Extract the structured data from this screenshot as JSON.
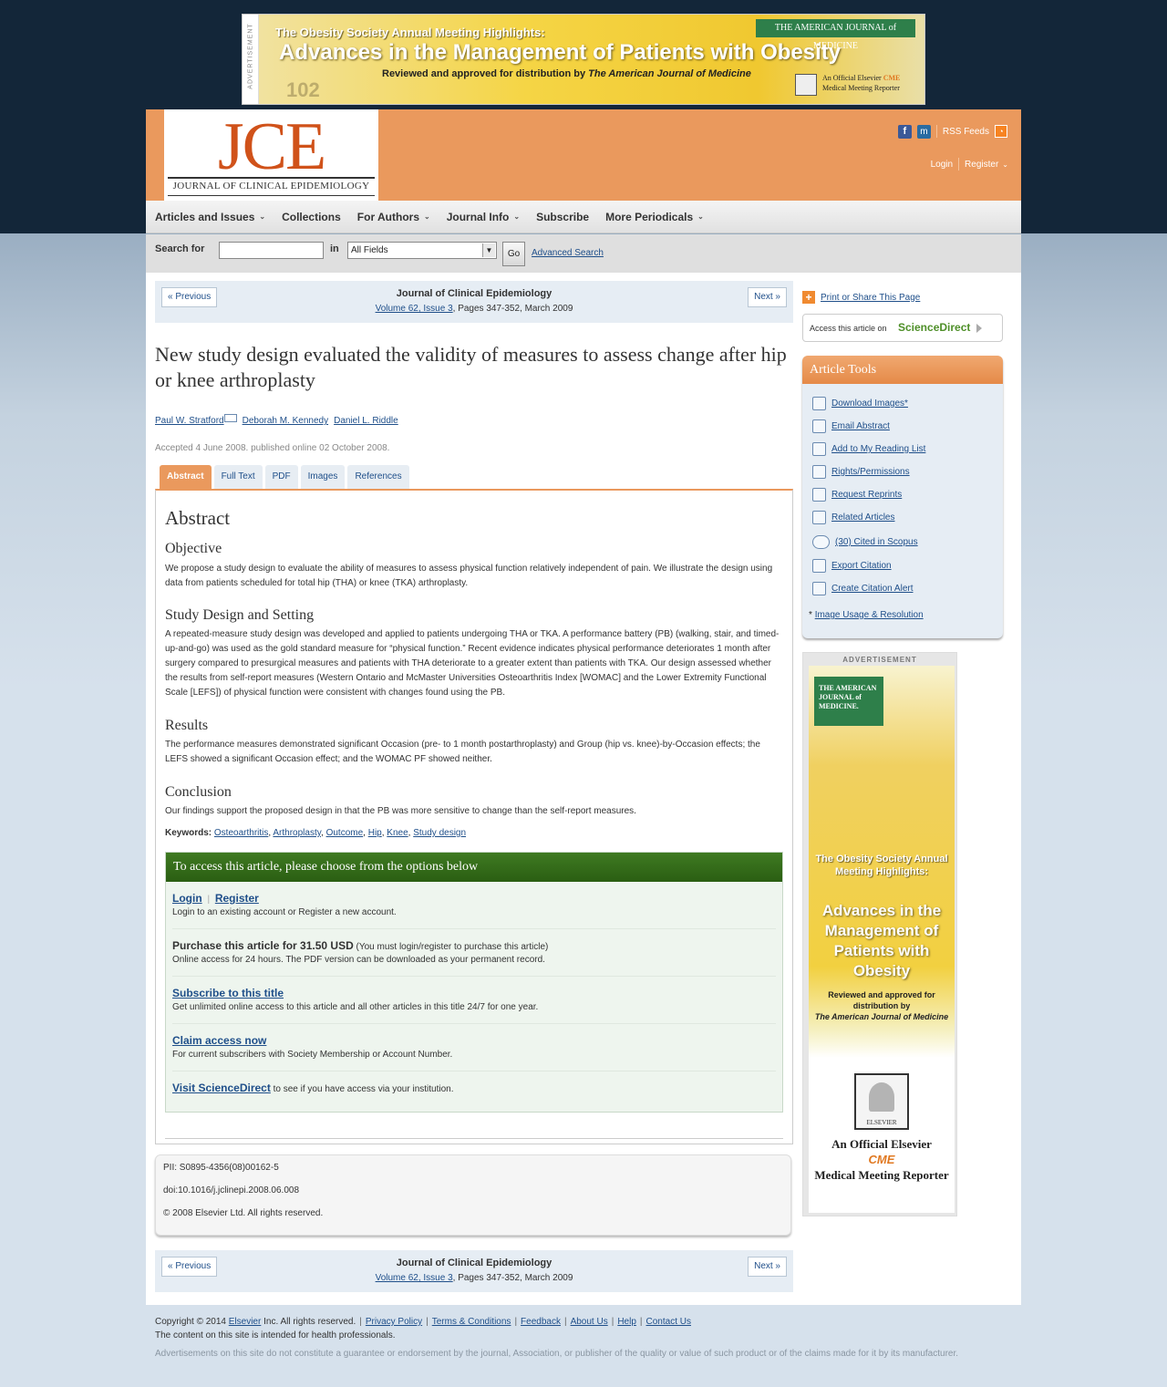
{
  "top_ad": {
    "side_label": "ADVERTISEMENT",
    "line1": "The Obesity Society Annual Meeting Highlights:",
    "line2": "Advances in the Management of Patients with Obesity",
    "line3_prefix": "Reviewed and approved for distribution by",
    "line3_journal": "The American Journal of Medicine",
    "publisher": "THE AMERICAN JOURNAL of MEDICINE",
    "cme_line1": "An Official Elsevier",
    "cme_badge": "CME",
    "cme_line2": "Medical Meeting Reporter",
    "number": "102"
  },
  "header": {
    "logo_text": "JCE",
    "logo_subtitle": "JOURNAL OF CLINICAL EPIDEMIOLOGY",
    "facebook_glyph": "f",
    "mendeley_glyph": "m",
    "rss_label": "RSS Feeds",
    "login": "Login",
    "register": "Register"
  },
  "nav": {
    "items": [
      {
        "label": "Articles and Issues",
        "dropdown": true
      },
      {
        "label": "Collections",
        "dropdown": false
      },
      {
        "label": "For Authors",
        "dropdown": true
      },
      {
        "label": "Journal Info",
        "dropdown": true
      },
      {
        "label": "Subscribe",
        "dropdown": false
      },
      {
        "label": "More Periodicals",
        "dropdown": true
      }
    ]
  },
  "search": {
    "label": "Search for",
    "input_value": "",
    "in_label": "in",
    "field_selected": "All Fields",
    "go_label": "Go",
    "advanced_label": "Advanced Search"
  },
  "issue_nav": {
    "prev_label": "« Previous",
    "next_label": "Next »",
    "journal": "Journal of Clinical Epidemiology",
    "volume_link": "Volume 62, Issue 3",
    "pages": ", Pages 347-352, March 2009"
  },
  "article": {
    "title": "New study design evaluated the validity of measures to assess change after hip or knee arthroplasty",
    "authors": [
      "Paul W. Stratford",
      "Deborah M. Kennedy",
      "Daniel L. Riddle"
    ],
    "accepted": "Accepted 4 June 2008. published online 02 October 2008.",
    "tabs": [
      "Abstract",
      "Full Text",
      "PDF",
      "Images",
      "References"
    ],
    "active_tab": "Abstract"
  },
  "abstract": {
    "heading": "Abstract",
    "sections": [
      {
        "heading": "Objective",
        "text": "We propose a study design to evaluate the ability of measures to assess physical function relatively independent of pain. We illustrate the design using data from patients scheduled for total hip (THA) or knee (TKA) arthroplasty."
      },
      {
        "heading": "Study Design and Setting",
        "text": "A repeated-measure study design was developed and applied to patients undergoing THA or TKA. A performance battery (PB) (walking, stair, and timed-up-and-go) was used as the gold standard measure for “physical function.” Recent evidence indicates physical performance deteriorates 1 month after surgery compared to presurgical measures and patients with THA deteriorate to a greater extent than patients with TKA. Our design assessed whether the results from self-report measures (Western Ontario and McMaster Universities Osteoarthritis Index [WOMAC] and the Lower Extremity Functional Scale [LEFS]) of physical function were consistent with changes found using the PB."
      },
      {
        "heading": "Results",
        "text": "The performance measures demonstrated significant Occasion (pre- to 1 month postarthroplasty) and Group (hip vs. knee)-by-Occasion effects; the LEFS showed a significant Occasion effect; and the WOMAC PF showed neither."
      },
      {
        "heading": "Conclusion",
        "text": "Our findings support the proposed design in that the PB was more sensitive to change than the self-report measures."
      }
    ],
    "keywords_label": "Keywords:",
    "keywords": [
      "Osteoarthritis",
      "Arthroplasty",
      "Outcome",
      "Hip",
      "Knee",
      "Study design"
    ]
  },
  "access": {
    "heading": "To access this article, please choose from the options below",
    "login": "Login",
    "register": "Register",
    "login_desc": "Login to an existing account or Register a new account.",
    "purchase_title": "Purchase this article for 31.50 USD",
    "purchase_note": "(You must login/register to purchase this article)",
    "purchase_desc": "Online access for 24 hours. The PDF version can be downloaded as your permanent record.",
    "subscribe_title": "Subscribe to this title",
    "subscribe_desc": "Get unlimited online access to this article and all other articles in this title 24/7 for one year.",
    "claim_title": "Claim access now",
    "claim_desc": "For current subscribers with Society Membership or Account Number.",
    "visit_title": "Visit ScienceDirect",
    "visit_desc": "to see if you have access via your institution."
  },
  "identifiers": {
    "pii": "PII: S0895-4356(08)00162-5",
    "doi": "doi:10.1016/j.jclinepi.2008.06.008",
    "copyright": "© 2008 Elsevier Ltd. All rights reserved."
  },
  "sidebar": {
    "print_share": "Print or Share This Page",
    "access_on": "Access this article on",
    "sciencedirect": "ScienceDirect",
    "tools_heading": "Article Tools",
    "tools": [
      {
        "label": "Download Images*",
        "icon": "download-images-icon"
      },
      {
        "label": "Email Abstract",
        "icon": "email-icon"
      },
      {
        "label": "Add to My Reading List",
        "icon": "reading-list-icon"
      },
      {
        "label": "Rights/Permissions",
        "icon": "lock-icon"
      },
      {
        "label": "Request Reprints",
        "icon": "reprints-icon"
      },
      {
        "label": "Related Articles",
        "icon": "related-articles-icon"
      },
      {
        "label": "(30) Cited in Scopus",
        "icon": "scopus-icon"
      },
      {
        "label": "Export Citation",
        "icon": "export-icon"
      },
      {
        "label": "Create Citation Alert",
        "icon": "alert-icon"
      }
    ],
    "footnote_star": "*",
    "footnote_link": "Image Usage & Resolution",
    "ad": {
      "label": "ADVERTISEMENT",
      "publisher": "THE AMERICAN JOURNAL of MEDICINE.",
      "line1": "The Obesity Society Annual Meeting Highlights:",
      "line2": "Advances in the Management of Patients with Obesity",
      "line3": "Reviewed and approved for distribution by",
      "line3_journal": "The American Journal of Medicine",
      "elsevier": "ELSEVIER",
      "official": "An Official Elsevier",
      "cme": "CME",
      "reporter": "Medical Meeting Reporter"
    }
  },
  "footer": {
    "copyright_prefix": "Copyright © 2014",
    "elsevier_link": "Elsevier",
    "copyright_suffix": "Inc. All rights reserved.",
    "links": [
      "Privacy Policy",
      "Terms & Conditions",
      "Feedback",
      "About Us",
      "Help",
      "Contact Us"
    ],
    "notice": "The content on this site is intended for health professionals.",
    "disclaimer": "Advertisements on this site do not constitute a guarantee or endorsement by the journal, Association, or publisher of the quality or value of such product or of the claims made for it by its manufacturer."
  },
  "colors": {
    "header_orange": "#ea995d",
    "page_navy": "#132639",
    "link_blue": "#1f4f8a",
    "access_green": "#3f7a22",
    "sciencedirect_green": "#4e8f28"
  }
}
